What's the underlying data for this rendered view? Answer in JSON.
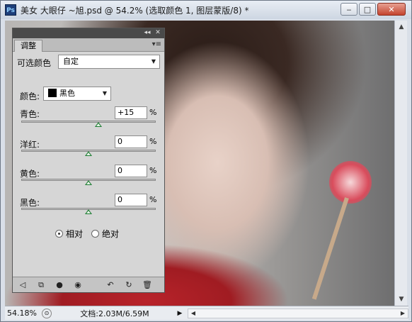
{
  "window": {
    "app_icon": "Ps",
    "title": "美女 大眼仔 ~旭.psd @ 54.2% (选取颜色 1, 图层蒙版/8) *",
    "buttons": {
      "minimize": "‒",
      "maximize": "□",
      "close": "✕"
    }
  },
  "panel": {
    "header_controls": {
      "collapse": "◂◂",
      "close": "✕"
    },
    "tab": "调整",
    "menu_icon": "▾≡",
    "title_label": "可选颜色",
    "preset": "自定",
    "color_label": "颜色:",
    "color_value": "黑色",
    "sliders": [
      {
        "label": "青色:",
        "value": "+15",
        "unit": "%",
        "level": 0.575
      },
      {
        "label": "洋红:",
        "value": "0",
        "unit": "%",
        "level": 0.5
      },
      {
        "label": "黄色:",
        "value": "0",
        "unit": "%",
        "level": 0.5
      },
      {
        "label": "黑色:",
        "value": "0",
        "unit": "%",
        "level": 0.5
      }
    ],
    "method": {
      "relative": "相对",
      "absolute": "绝对",
      "selected": "relative"
    },
    "bottom_icons": [
      "back-arrow-icon",
      "clip-layer-icon",
      "mask-icon",
      "eye-icon",
      "previous-state-icon",
      "reset-icon",
      "trash-icon"
    ]
  },
  "status": {
    "zoom": "54.18%",
    "doc": "文档:2.03M/6.59M"
  }
}
